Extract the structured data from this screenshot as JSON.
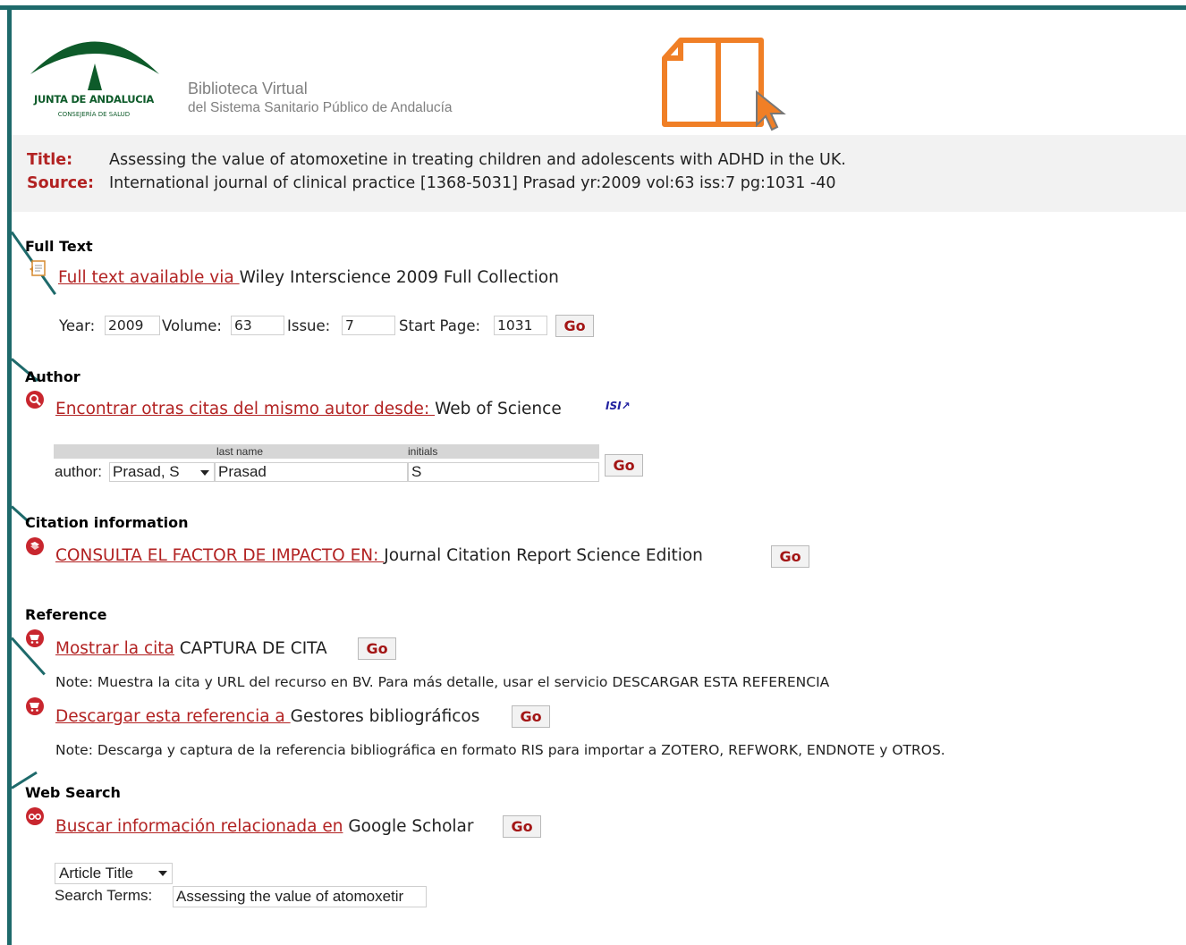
{
  "header": {
    "logo_line1": "JUNTA DE ANDALUCIA",
    "logo_line2": "CONSEJERÍA DE SALUD",
    "site_title": "Biblioteca Virtual",
    "site_subtitle": "del Sistema Sanitario Público de Andalucía",
    "brand_color": "#f07f26"
  },
  "record": {
    "title_label": "Title:",
    "title_value": "Assessing the value of atomoxetine in treating children and adolescents with ADHD in the UK.",
    "source_label": "Source:",
    "source_value": "International journal of clinical practice [1368-5031] Prasad yr:2009 vol:63 iss:7 pg:1031 -40"
  },
  "fulltext": {
    "heading": "Full Text",
    "icon": "fulltext-doc-icon",
    "link": "Full text available via ",
    "target": "Wiley Interscience 2009 Full Collection",
    "year_label": "Year:",
    "year_value": "2009",
    "volume_label": "Volume:",
    "volume_value": "63",
    "issue_label": "Issue:",
    "issue_value": "7",
    "startpage_label": "Start Page:",
    "startpage_value": "1031",
    "go": "Go"
  },
  "author": {
    "heading": "Author",
    "icon": "author-search-icon",
    "link": "Encontrar otras citas del mismo autor desde: ",
    "target": "Web of Science",
    "isi_badge": "ISI",
    "last_name_hdr": "last name",
    "initials_hdr": "initials",
    "author_label": "author:",
    "author_select": "Prasad, S",
    "last_name_value": "Prasad",
    "initials_value": "S",
    "go": "Go"
  },
  "citation": {
    "heading": "Citation information",
    "icon": "citation-book-icon",
    "link": "CONSULTA EL FACTOR DE IMPACTO EN: ",
    "target": "Journal Citation Report Science Edition",
    "go": "Go"
  },
  "reference": {
    "heading": "Reference",
    "icon": "cart-icon",
    "show_link": "Mostrar la cita",
    "show_target": " CAPTURA DE CITA",
    "show_go": "Go",
    "show_note": "Note: Muestra la cita y URL del recurso en BV. Para más detalle, usar el servicio DESCARGAR ESTA REFERENCIA",
    "download_link": "Descargar esta referencia a ",
    "download_target": "Gestores bibliográficos",
    "download_go": "Go",
    "download_note": "Note: Descarga y captura de la referencia bibliográfica en formato RIS para importar a ZOTERO, REFWORK, ENDNOTE y OTROS."
  },
  "websearch": {
    "heading": "Web Search",
    "icon": "glasses-icon",
    "link": "Buscar información relacionada en",
    "target": " Google Scholar",
    "go": "Go",
    "select": "Article Title",
    "terms_label": "Search Terms:",
    "terms_value": "Assessing the value of atomoxetir"
  }
}
